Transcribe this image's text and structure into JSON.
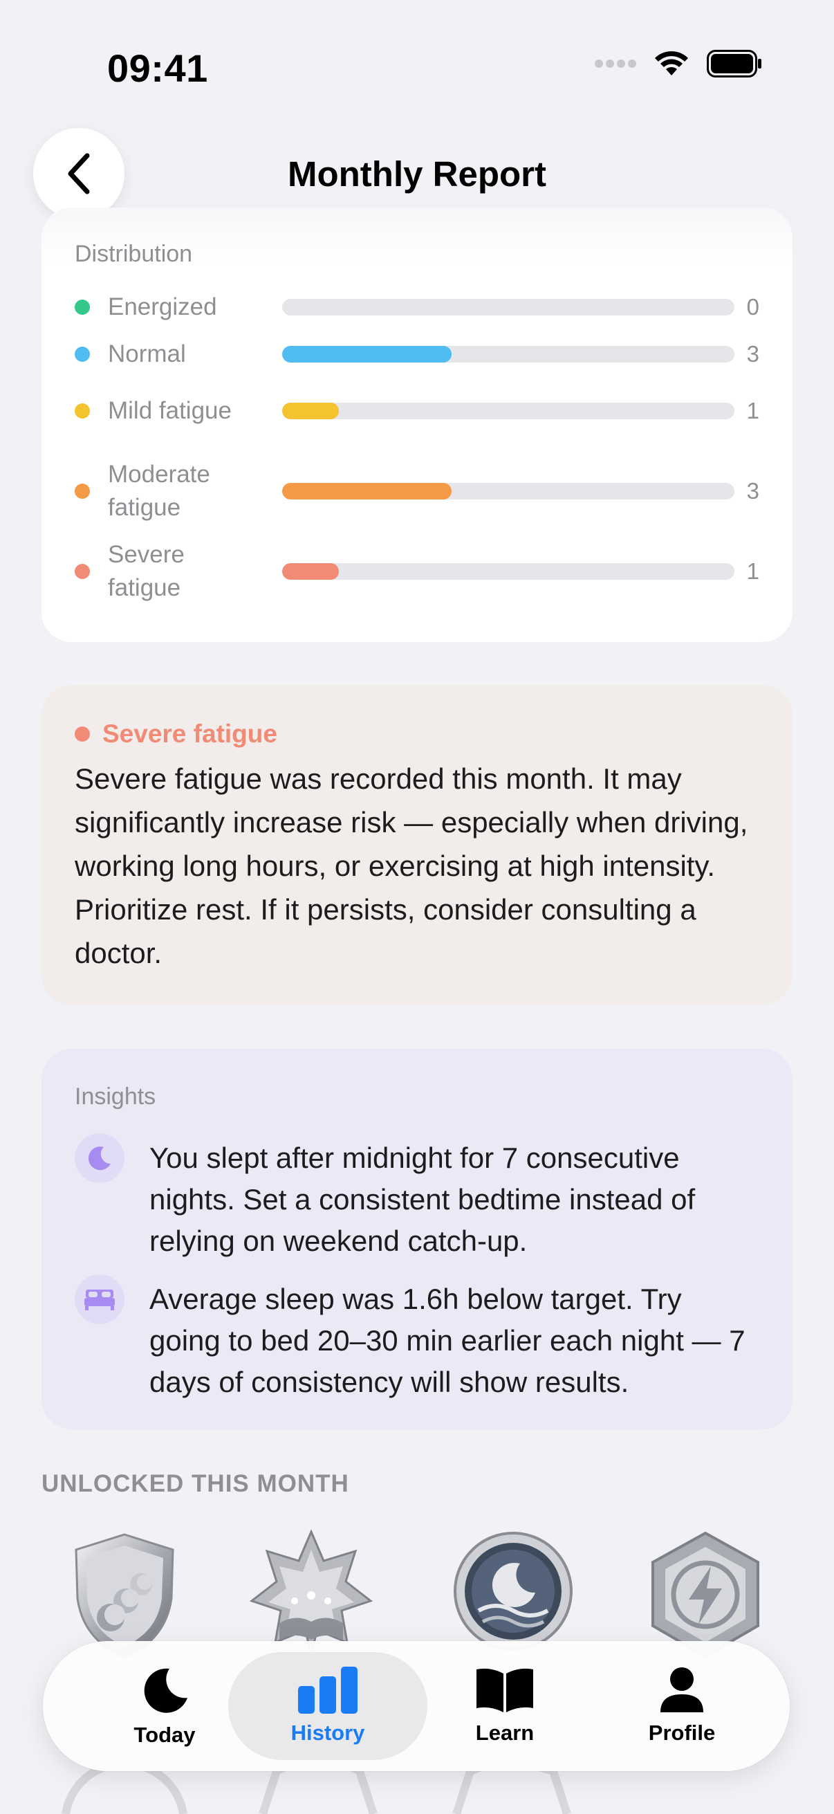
{
  "status_bar": {
    "time": "09:41"
  },
  "header": {
    "title": "Monthly Report"
  },
  "distribution": {
    "label": "Distribution",
    "max": 8,
    "rows": [
      {
        "label": "Energized",
        "count": "0",
        "value": 0,
        "color": "#34c78a"
      },
      {
        "label": "Normal",
        "count": "3",
        "value": 3,
        "color": "#4fbcf2"
      },
      {
        "label": "Mild fatigue",
        "count": "1",
        "value": 1,
        "color": "#f5c230"
      },
      {
        "label": "Moderate fatigue",
        "count": "3",
        "value": 3,
        "color": "#f59a45"
      },
      {
        "label": "Severe fatigue",
        "count": "1",
        "value": 1,
        "color": "#f28b75"
      }
    ]
  },
  "alert": {
    "title": "Severe fatigue",
    "color": "#f28b75",
    "body": "Severe fatigue was recorded this month. It may significantly increase risk — especially when driving, working long hours, or exercising at high intensity. Prioritize rest. If it persists, consider consulting a doctor."
  },
  "insights": {
    "label": "Insights",
    "items": [
      {
        "icon": "moon-icon",
        "text": "You slept after midnight for 7 consecutive nights. Set a consistent bedtime instead of relying on weekend catch-up."
      },
      {
        "icon": "bed-icon",
        "text": "Average sleep was 1.6h below target. Try going to bed 20–30 min earlier each night — 7 days of consistency will show results."
      }
    ]
  },
  "unlocked": {
    "label": "UNLOCKED THIS MONTH",
    "badges": [
      "shield-badge-icon",
      "star-book-badge-icon",
      "moon-waves-badge-icon",
      "lightning-hex-badge-icon"
    ]
  },
  "tabbar": {
    "tabs": [
      {
        "label": "Today",
        "icon": "moon-icon",
        "active": false
      },
      {
        "label": "History",
        "icon": "bar-chart-icon",
        "active": true
      },
      {
        "label": "Learn",
        "icon": "book-icon",
        "active": false
      },
      {
        "label": "Profile",
        "icon": "person-icon",
        "active": false
      }
    ],
    "accent": "#1a7cf5"
  }
}
